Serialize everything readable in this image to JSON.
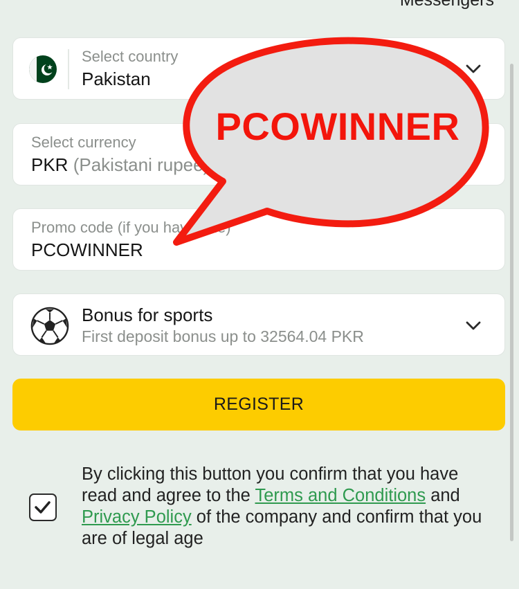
{
  "header": {
    "top_cut_text": "Messengers"
  },
  "country": {
    "label": "Select country",
    "value": "Pakistan",
    "flag_icon": "pakistan-flag-icon"
  },
  "currency": {
    "label": "Select currency",
    "value": "PKR",
    "value_detail": "(Pakistani rupee)"
  },
  "promo": {
    "label": "Promo code (if you have one)",
    "value": "PCOWINNER"
  },
  "bonus": {
    "title": "Bonus for sports",
    "subtitle": "First deposit bonus up to 32564.04 PKR",
    "icon": "soccer-ball-icon"
  },
  "register": {
    "label": "REGISTER"
  },
  "agreement": {
    "checked": true,
    "text_1": "By clicking this button you confirm that you have read and agree to the ",
    "terms_link": "Terms and Conditions",
    "text_2": " and ",
    "privacy_link": "Privacy Policy",
    "text_3": " of the company and confirm that you are of legal age"
  },
  "callout": {
    "text": "PCOWINNER"
  },
  "colors": {
    "accent_yellow": "#fdcc00",
    "link_green": "#2f9a4f",
    "callout_red": "#f3150b",
    "background": "#e8efea"
  }
}
